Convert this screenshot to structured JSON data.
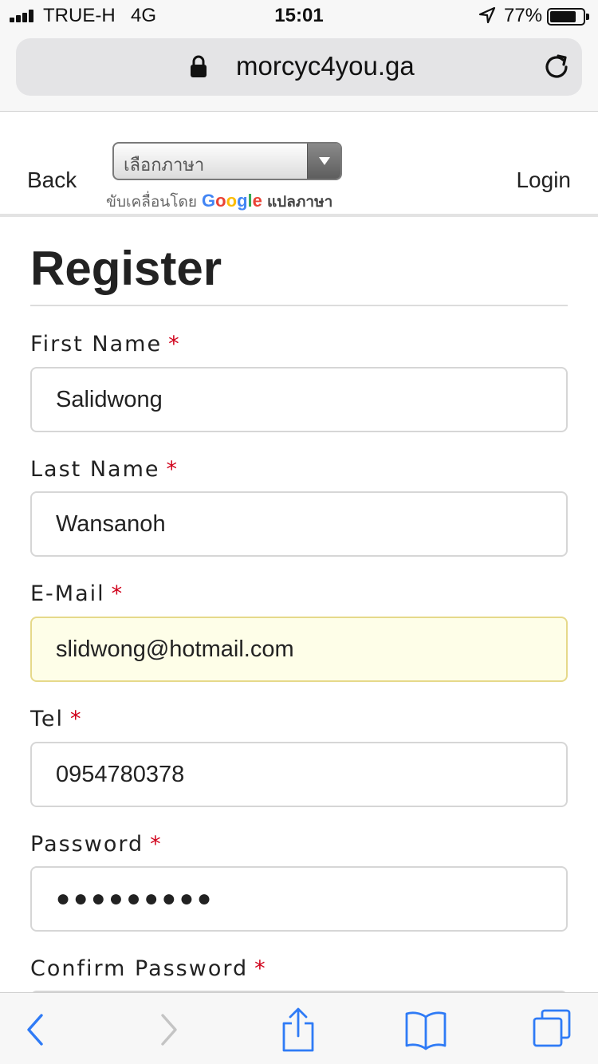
{
  "status_bar": {
    "carrier": "TRUE-H",
    "network": "4G",
    "time": "15:01",
    "battery_percent": "77%"
  },
  "browser": {
    "url": "morcyc4you.ga"
  },
  "header": {
    "back_label": "Back",
    "login_label": "Login",
    "language_select": {
      "value": "เลือกภาษา"
    },
    "powered_by": {
      "prefix": "ขับเคลื่อนโดย",
      "google": [
        "G",
        "o",
        "o",
        "g",
        "l",
        "e"
      ],
      "suffix": "แปลภาษา"
    }
  },
  "form": {
    "title": "Register",
    "required_marker": "*",
    "fields": [
      {
        "label": "First Name",
        "value": "Salidwong"
      },
      {
        "label": "Last Name",
        "value": "Wansanoh"
      },
      {
        "label": "E-Mail",
        "value": "slidwong@hotmail.com"
      },
      {
        "label": "Tel",
        "value": "0954780378"
      },
      {
        "label": "Password",
        "value": "●●●●●●●●●"
      },
      {
        "label": "Confirm Password",
        "value": ""
      }
    ]
  },
  "colors": {
    "required": "#d0021b",
    "autofill_bg": "#fefee8",
    "ios_blue": "#2f7bf6"
  },
  "toolbar": {
    "icons": [
      "back-chevron-icon",
      "forward-chevron-icon",
      "share-icon",
      "bookmarks-icon",
      "tabs-icon"
    ]
  }
}
